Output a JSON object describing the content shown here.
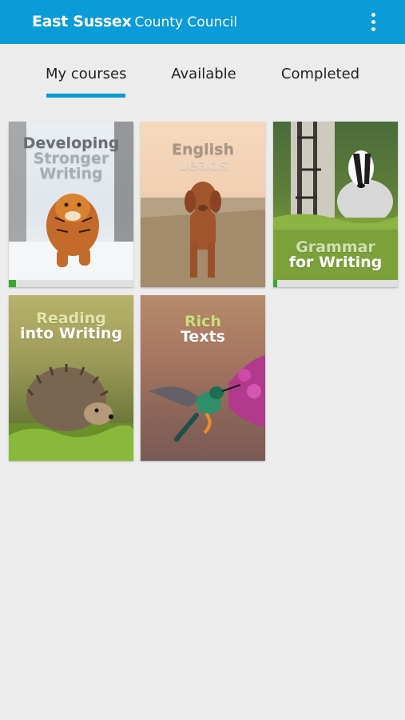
{
  "header": {
    "brand_bold": "East Sussex",
    "brand_regular": "County Council"
  },
  "tabs": [
    {
      "label": "My courses",
      "selected": true
    },
    {
      "label": "Available",
      "selected": false
    },
    {
      "label": "Completed",
      "selected": false
    }
  ],
  "colors": {
    "appbar": "#0a9bd8",
    "progress": "#3aa832",
    "background": "#ececec"
  },
  "courses": [
    {
      "title_line1": "Developing",
      "title_line2": "Stronger",
      "title_line3": "Writing",
      "image": "tiger",
      "progress": 0.06
    },
    {
      "title_line1": "English",
      "title_line2": "Leads",
      "image": "dog"
    },
    {
      "title_line1": "Grammar",
      "title_line2": "for Writing",
      "image": "badger",
      "progress": 0.03
    },
    {
      "title_line1": "Reading",
      "title_line2": "into Writing",
      "image": "hedgehog"
    },
    {
      "title_line1": "Rich",
      "title_line2": "Texts",
      "image": "hummingbird"
    }
  ]
}
